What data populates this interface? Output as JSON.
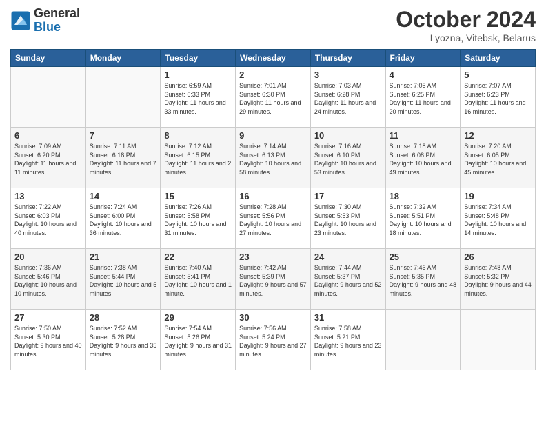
{
  "header": {
    "logo_general": "General",
    "logo_blue": "Blue",
    "month_title": "October 2024",
    "location": "Lyozna, Vitebsk, Belarus"
  },
  "weekdays": [
    "Sunday",
    "Monday",
    "Tuesday",
    "Wednesday",
    "Thursday",
    "Friday",
    "Saturday"
  ],
  "weeks": [
    [
      {
        "day": "",
        "sunrise": "",
        "sunset": "",
        "daylight": ""
      },
      {
        "day": "",
        "sunrise": "",
        "sunset": "",
        "daylight": ""
      },
      {
        "day": "1",
        "sunrise": "Sunrise: 6:59 AM",
        "sunset": "Sunset: 6:33 PM",
        "daylight": "Daylight: 11 hours and 33 minutes."
      },
      {
        "day": "2",
        "sunrise": "Sunrise: 7:01 AM",
        "sunset": "Sunset: 6:30 PM",
        "daylight": "Daylight: 11 hours and 29 minutes."
      },
      {
        "day": "3",
        "sunrise": "Sunrise: 7:03 AM",
        "sunset": "Sunset: 6:28 PM",
        "daylight": "Daylight: 11 hours and 24 minutes."
      },
      {
        "day": "4",
        "sunrise": "Sunrise: 7:05 AM",
        "sunset": "Sunset: 6:25 PM",
        "daylight": "Daylight: 11 hours and 20 minutes."
      },
      {
        "day": "5",
        "sunrise": "Sunrise: 7:07 AM",
        "sunset": "Sunset: 6:23 PM",
        "daylight": "Daylight: 11 hours and 16 minutes."
      }
    ],
    [
      {
        "day": "6",
        "sunrise": "Sunrise: 7:09 AM",
        "sunset": "Sunset: 6:20 PM",
        "daylight": "Daylight: 11 hours and 11 minutes."
      },
      {
        "day": "7",
        "sunrise": "Sunrise: 7:11 AM",
        "sunset": "Sunset: 6:18 PM",
        "daylight": "Daylight: 11 hours and 7 minutes."
      },
      {
        "day": "8",
        "sunrise": "Sunrise: 7:12 AM",
        "sunset": "Sunset: 6:15 PM",
        "daylight": "Daylight: 11 hours and 2 minutes."
      },
      {
        "day": "9",
        "sunrise": "Sunrise: 7:14 AM",
        "sunset": "Sunset: 6:13 PM",
        "daylight": "Daylight: 10 hours and 58 minutes."
      },
      {
        "day": "10",
        "sunrise": "Sunrise: 7:16 AM",
        "sunset": "Sunset: 6:10 PM",
        "daylight": "Daylight: 10 hours and 53 minutes."
      },
      {
        "day": "11",
        "sunrise": "Sunrise: 7:18 AM",
        "sunset": "Sunset: 6:08 PM",
        "daylight": "Daylight: 10 hours and 49 minutes."
      },
      {
        "day": "12",
        "sunrise": "Sunrise: 7:20 AM",
        "sunset": "Sunset: 6:05 PM",
        "daylight": "Daylight: 10 hours and 45 minutes."
      }
    ],
    [
      {
        "day": "13",
        "sunrise": "Sunrise: 7:22 AM",
        "sunset": "Sunset: 6:03 PM",
        "daylight": "Daylight: 10 hours and 40 minutes."
      },
      {
        "day": "14",
        "sunrise": "Sunrise: 7:24 AM",
        "sunset": "Sunset: 6:00 PM",
        "daylight": "Daylight: 10 hours and 36 minutes."
      },
      {
        "day": "15",
        "sunrise": "Sunrise: 7:26 AM",
        "sunset": "Sunset: 5:58 PM",
        "daylight": "Daylight: 10 hours and 31 minutes."
      },
      {
        "day": "16",
        "sunrise": "Sunrise: 7:28 AM",
        "sunset": "Sunset: 5:56 PM",
        "daylight": "Daylight: 10 hours and 27 minutes."
      },
      {
        "day": "17",
        "sunrise": "Sunrise: 7:30 AM",
        "sunset": "Sunset: 5:53 PM",
        "daylight": "Daylight: 10 hours and 23 minutes."
      },
      {
        "day": "18",
        "sunrise": "Sunrise: 7:32 AM",
        "sunset": "Sunset: 5:51 PM",
        "daylight": "Daylight: 10 hours and 18 minutes."
      },
      {
        "day": "19",
        "sunrise": "Sunrise: 7:34 AM",
        "sunset": "Sunset: 5:48 PM",
        "daylight": "Daylight: 10 hours and 14 minutes."
      }
    ],
    [
      {
        "day": "20",
        "sunrise": "Sunrise: 7:36 AM",
        "sunset": "Sunset: 5:46 PM",
        "daylight": "Daylight: 10 hours and 10 minutes."
      },
      {
        "day": "21",
        "sunrise": "Sunrise: 7:38 AM",
        "sunset": "Sunset: 5:44 PM",
        "daylight": "Daylight: 10 hours and 5 minutes."
      },
      {
        "day": "22",
        "sunrise": "Sunrise: 7:40 AM",
        "sunset": "Sunset: 5:41 PM",
        "daylight": "Daylight: 10 hours and 1 minute."
      },
      {
        "day": "23",
        "sunrise": "Sunrise: 7:42 AM",
        "sunset": "Sunset: 5:39 PM",
        "daylight": "Daylight: 9 hours and 57 minutes."
      },
      {
        "day": "24",
        "sunrise": "Sunrise: 7:44 AM",
        "sunset": "Sunset: 5:37 PM",
        "daylight": "Daylight: 9 hours and 52 minutes."
      },
      {
        "day": "25",
        "sunrise": "Sunrise: 7:46 AM",
        "sunset": "Sunset: 5:35 PM",
        "daylight": "Daylight: 9 hours and 48 minutes."
      },
      {
        "day": "26",
        "sunrise": "Sunrise: 7:48 AM",
        "sunset": "Sunset: 5:32 PM",
        "daylight": "Daylight: 9 hours and 44 minutes."
      }
    ],
    [
      {
        "day": "27",
        "sunrise": "Sunrise: 7:50 AM",
        "sunset": "Sunset: 5:30 PM",
        "daylight": "Daylight: 9 hours and 40 minutes."
      },
      {
        "day": "28",
        "sunrise": "Sunrise: 7:52 AM",
        "sunset": "Sunset: 5:28 PM",
        "daylight": "Daylight: 9 hours and 35 minutes."
      },
      {
        "day": "29",
        "sunrise": "Sunrise: 7:54 AM",
        "sunset": "Sunset: 5:26 PM",
        "daylight": "Daylight: 9 hours and 31 minutes."
      },
      {
        "day": "30",
        "sunrise": "Sunrise: 7:56 AM",
        "sunset": "Sunset: 5:24 PM",
        "daylight": "Daylight: 9 hours and 27 minutes."
      },
      {
        "day": "31",
        "sunrise": "Sunrise: 7:58 AM",
        "sunset": "Sunset: 5:21 PM",
        "daylight": "Daylight: 9 hours and 23 minutes."
      },
      {
        "day": "",
        "sunrise": "",
        "sunset": "",
        "daylight": ""
      },
      {
        "day": "",
        "sunrise": "",
        "sunset": "",
        "daylight": ""
      }
    ]
  ]
}
